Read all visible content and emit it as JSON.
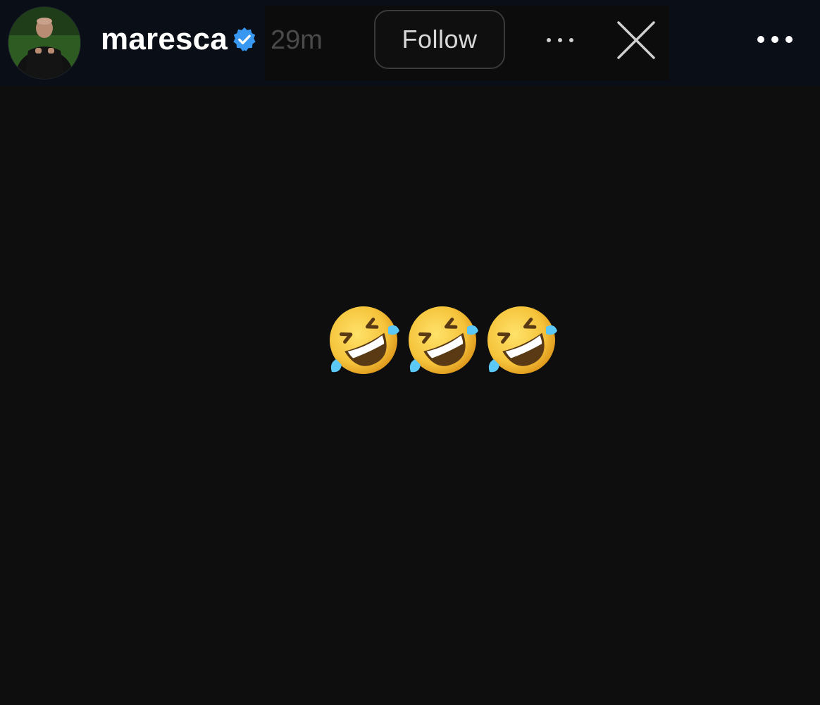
{
  "story_header": {
    "username": "maresca",
    "time_ago": "29m",
    "follow_label": "Follow",
    "verified_icon": "verified-badge-icon",
    "verified_color": "#3897f0",
    "more_icon": "more-dots-icon",
    "close_icon": "close-icon",
    "avatar_icon": "profile-avatar"
  },
  "story_content": {
    "text": "🤣🤣🤣",
    "emoji_name": "rolling-on-the-floor-laughing",
    "emoji_count": 3
  }
}
